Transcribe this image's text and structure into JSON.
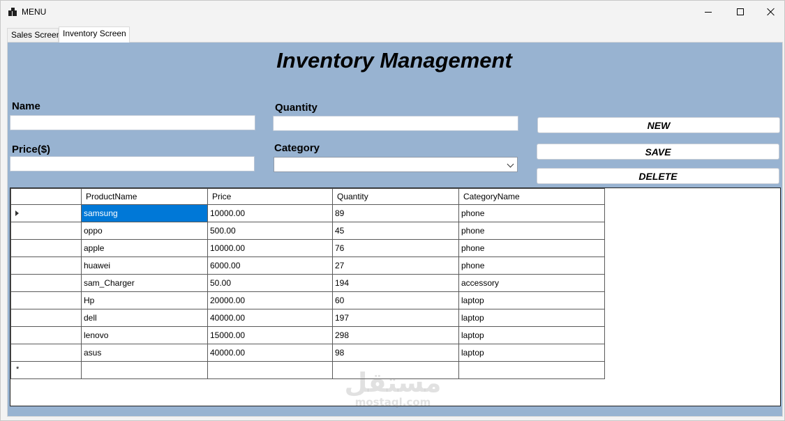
{
  "window": {
    "title": "MENU"
  },
  "tabs": [
    {
      "label": "Sales Screen",
      "active": false
    },
    {
      "label": "Inventory Screen",
      "active": true
    }
  ],
  "form": {
    "heading": "Inventory Management",
    "name": {
      "label": "Name",
      "value": ""
    },
    "quantity": {
      "label": "Quantity",
      "value": ""
    },
    "price": {
      "label": "Price($)",
      "value": ""
    },
    "category": {
      "label": "Category",
      "value": ""
    }
  },
  "buttons": {
    "new": "NEW",
    "save": "SAVE",
    "delete": "DELETE"
  },
  "grid": {
    "columns": [
      "ProductName",
      "Price",
      "Quantity",
      "CategoryName"
    ],
    "rows": [
      [
        "samsung",
        "10000.00",
        "89",
        "phone"
      ],
      [
        "oppo",
        "500.00",
        "45",
        "phone"
      ],
      [
        "apple",
        "10000.00",
        "76",
        "phone"
      ],
      [
        "huawei",
        "6000.00",
        "27",
        "phone"
      ],
      [
        "sam_Charger",
        "50.00",
        "194",
        "accessory"
      ],
      [
        "Hp",
        "20000.00",
        "60",
        "laptop"
      ],
      [
        "dell",
        "40000.00",
        "197",
        "laptop"
      ],
      [
        "lenovo",
        "15000.00",
        "298",
        "laptop"
      ],
      [
        "asus",
        "40000.00",
        "98",
        "laptop"
      ]
    ],
    "selected_row": 0,
    "new_row_marker": "*"
  },
  "watermark": {
    "arabic": "مستقل",
    "latin": "mostaql.com"
  },
  "colors": {
    "panel": "#98b3d1",
    "selection": "#0078d7"
  }
}
